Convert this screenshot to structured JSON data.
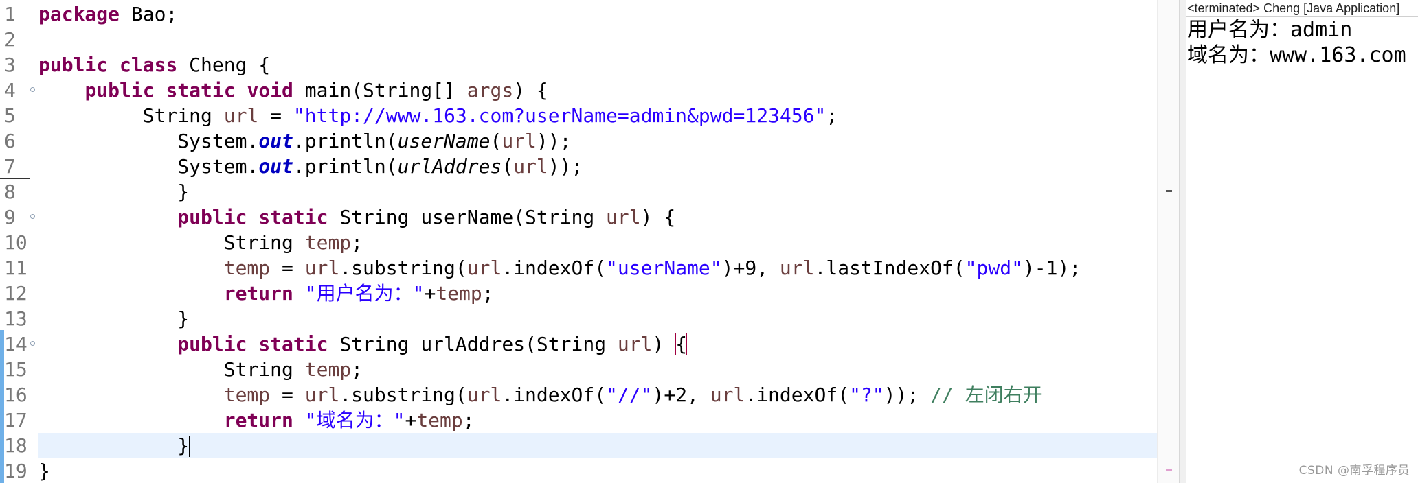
{
  "editor": {
    "line_numbers": [
      "1",
      "2",
      "3",
      "4",
      "5",
      "6",
      "7",
      "8",
      "9",
      "10",
      "11",
      "12",
      "13",
      "14",
      "15",
      "16",
      "17",
      "18",
      "19"
    ],
    "lines": {
      "l1": {
        "kw": "package",
        "rest": " Bao;"
      },
      "l3": {
        "kw1": "public",
        "kw2": "class",
        "rest": " Cheng {"
      },
      "l4": {
        "indent": "    ",
        "kw1": "public",
        "kw2": "static",
        "kw3": "void",
        "mid": " main(String[] ",
        "param": "args",
        "end": ") {"
      },
      "l5": {
        "indent": "         ",
        "type": "String ",
        "var": "url",
        "eq": " = ",
        "str": "\"http://www.163.com?userName=admin&pwd=123456\"",
        "end": ";"
      },
      "l6": {
        "indent": "            ",
        "cls": "System.",
        "field": "out",
        "call": ".println(",
        "fn": "userName",
        "p1": "(",
        "arg": "url",
        "end": "));"
      },
      "l7": {
        "indent": "            ",
        "cls": "System.",
        "field": "out",
        "call": ".println(",
        "fn": "urlAddres",
        "p1": "(",
        "arg": "url",
        "end": "));"
      },
      "l8": {
        "indent": "            ",
        "text": "}"
      },
      "l9": {
        "indent": "            ",
        "kw1": "public",
        "kw2": "static",
        "mid": " String userName(String ",
        "param": "url",
        "end": ") {"
      },
      "l10": {
        "indent": "                ",
        "type": "String ",
        "var": "temp",
        "end": ";"
      },
      "l11": {
        "indent": "                ",
        "v1": "temp",
        "eq": " = ",
        "v2": "url",
        "a": ".substring(",
        "v3": "url",
        "b": ".indexOf(",
        "s1": "\"userName\"",
        "c": ")+9, ",
        "v4": "url",
        "d": ".lastIndexOf(",
        "s2": "\"pwd\"",
        "e": ")-1);"
      },
      "l12": {
        "indent": "                ",
        "kw": "return",
        "sp": " ",
        "str": "\"用户名为：\"",
        "plus": "+",
        "var": "temp",
        "end": ";"
      },
      "l13": {
        "indent": "            ",
        "text": "}"
      },
      "l14": {
        "indent": "            ",
        "kw1": "public",
        "kw2": "static",
        "mid": " String urlAddres(String ",
        "param": "url",
        "close": ") ",
        "brace": "{"
      },
      "l15": {
        "indent": "                ",
        "type": "String ",
        "var": "temp",
        "end": ";"
      },
      "l16": {
        "indent": "                ",
        "v1": "temp",
        "eq": " = ",
        "v2": "url",
        "a": ".substring(",
        "v3": "url",
        "b": ".indexOf(",
        "s1": "\"//\"",
        "c": ")+2, ",
        "v4": "url",
        "d": ".indexOf(",
        "s2": "\"?\"",
        "e": ")); ",
        "cmt": "// 左闭右开"
      },
      "l17": {
        "indent": "                ",
        "kw": "return",
        "sp": " ",
        "str": "\"域名为：\"",
        "plus": "+",
        "var": "temp",
        "end": ";"
      },
      "l18": {
        "indent": "            ",
        "text": "}"
      },
      "l19": {
        "text": "}"
      }
    }
  },
  "console": {
    "header": "<terminated> Cheng [Java Application]",
    "output": [
      "用户名为：admin",
      "域名为：www.163.com"
    ]
  },
  "watermark": "CSDN @南孚程序员",
  "colors": {
    "keyword": "#7f0055",
    "string": "#2a00ff",
    "field": "#0000c0",
    "local_var": "#6a3e3e",
    "comment": "#3f7f5f",
    "current_line": "#e8f2fe"
  }
}
